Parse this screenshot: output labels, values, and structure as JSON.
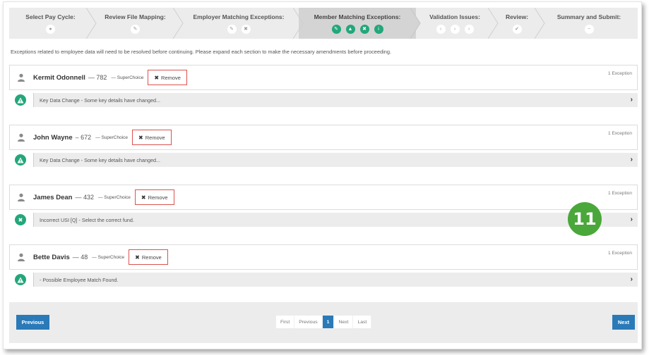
{
  "wizard": {
    "steps": [
      {
        "label": "Select Pay Cycle:",
        "icons": [
          "circle-icon"
        ],
        "active": false
      },
      {
        "label": "Review File Mapping:",
        "icons": [
          "pencil-icon"
        ],
        "active": false
      },
      {
        "label": "Employer Matching Exceptions:",
        "icons": [
          "pencil-icon",
          "x-icon"
        ],
        "active": false
      },
      {
        "label": "Member Matching Exceptions:",
        "icons": [
          "pencil-icon",
          "warning-icon",
          "x-icon",
          "info-icon"
        ],
        "active": true
      },
      {
        "label": "Validation Issues:",
        "icons": [
          "chevron-icon",
          "chevron-icon",
          "chevron-icon"
        ],
        "active": false
      },
      {
        "label": "Review:",
        "icons": [
          "check-icon"
        ],
        "active": false
      },
      {
        "label": "Summary and Submit:",
        "icons": [
          "minus-icon"
        ],
        "active": false
      }
    ]
  },
  "intro_text": "Exceptions related to employee data will need to be resolved before continuing. Please expand each section to make the necessary amendments before proceeding.",
  "members": [
    {
      "name": "Kermit Odonnell",
      "number": "— 782",
      "fund": "— SuperChoice",
      "remove_label": "Remove",
      "exception_count": "1 Exception",
      "status": "warning",
      "detail": "Key Data Change - Some key details have changed..."
    },
    {
      "name": "John Wayne",
      "number": "– 672",
      "fund": "— SuperChoice",
      "remove_label": "Remove",
      "exception_count": "1 Exception",
      "status": "warning",
      "detail": "Key Data Change - Some key details have changed..."
    },
    {
      "name": "James Dean",
      "number": "— 432",
      "fund": "— SuperChoice",
      "remove_label": "Remove",
      "exception_count": "1 Exception",
      "status": "error",
      "detail": "Incorrect USI [Q] - Select the correct fund."
    },
    {
      "name": "Bette Davis",
      "number": "— 48",
      "fund": "— SuperChoice",
      "remove_label": "Remove",
      "exception_count": "1 Exception",
      "status": "warning",
      "detail": "- Possible Employee Match Found."
    }
  ],
  "footer": {
    "previous_label": "Previous",
    "next_label": "Next",
    "pagination": [
      "First",
      "Previous",
      "1",
      "Next",
      "Last"
    ],
    "current_page": "1"
  },
  "callout_number": "11",
  "colors": {
    "accent_green": "#23a77a",
    "primary_blue": "#2a7ab8",
    "remove_border": "#d9534f",
    "callout_green": "#4aa73a"
  }
}
